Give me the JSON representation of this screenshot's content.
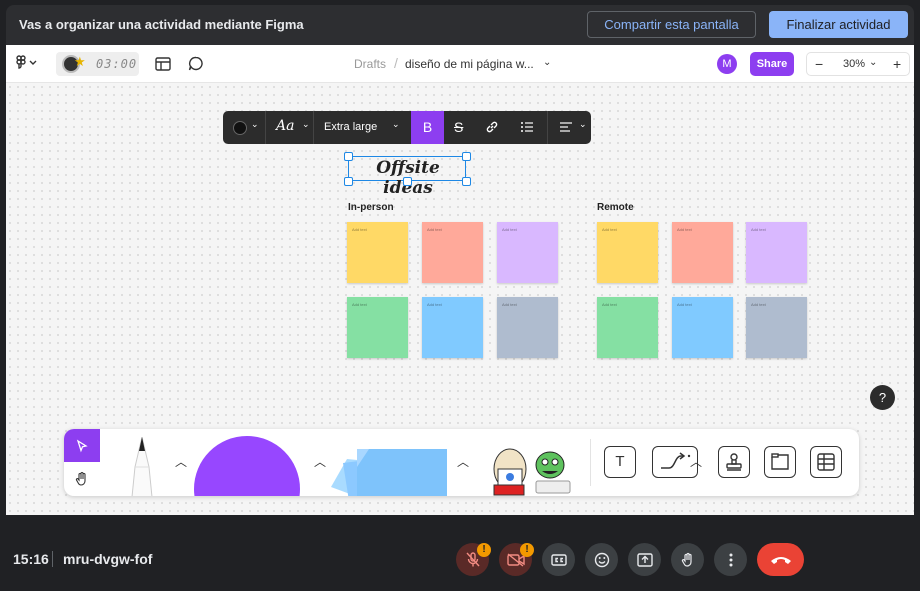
{
  "banner": {
    "title": "Vas a organizar una actividad mediante Figma",
    "share_label": "Compartir esta pantalla",
    "end_label": "Finalizar actividad"
  },
  "figma": {
    "timer": "03:00",
    "breadcrumb": {
      "drafts": "Drafts",
      "separator": "/",
      "file": "diseño de mi página w..."
    },
    "avatar_initial": "M",
    "share_label": "Share",
    "zoom": {
      "minus": "−",
      "value": "30%",
      "plus": "+"
    },
    "format_toolbar": {
      "font_icon": "Aa",
      "size": "Extra large",
      "bold": "B"
    },
    "canvas": {
      "title": "Offsite ideas",
      "groups": [
        {
          "label": "In-person",
          "notes": [
            "Add text",
            "Add text",
            "Add text",
            "Add text",
            "Add text",
            "Add text"
          ]
        },
        {
          "label": "Remote",
          "notes": [
            "Add text",
            "Add text",
            "Add text",
            "Add text",
            "Add text",
            "Add text"
          ]
        }
      ],
      "note_colors": [
        "#ffd966",
        "#ffa99a",
        "#d9b8ff",
        "#85e0a3",
        "#80caff",
        "#afbccf"
      ]
    },
    "help_label": "?",
    "dock": {
      "tools": [
        "move-tool",
        "hand-tool",
        "marker-tool",
        "shape-tool",
        "sticky-tool",
        "sticker-tool",
        "text-tool",
        "connector-tool",
        "stamp-tool",
        "section-tool",
        "table-tool"
      ],
      "text_tool": "T"
    }
  },
  "meet": {
    "clock": "15:16",
    "code": "mru-dvgw-fof",
    "warn_badge": "!"
  },
  "colors": {
    "accent": "#8d3ef0",
    "selection": "#1e88e5",
    "meet_blue": "#8ab4f8",
    "hangup_red": "#ea4335"
  }
}
